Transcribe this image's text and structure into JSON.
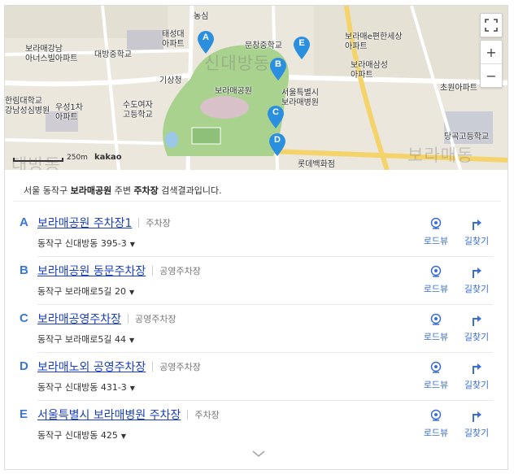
{
  "map": {
    "big_labels": [
      "신대방동",
      "보라매동",
      "대방동"
    ],
    "labels": [
      {
        "text": "농심",
        "key": "nongsim"
      },
      {
        "text": "태성대\n아파트",
        "key": "taesung"
      },
      {
        "text": "문창중학교",
        "key": "munchang"
      },
      {
        "text": "보라매강남\n아너스빌아파트",
        "key": "honors"
      },
      {
        "text": "대방중학교",
        "key": "daebang_ms"
      },
      {
        "text": "보라매e편한세상\n아파트",
        "key": "epyeonhan"
      },
      {
        "text": "보라매삼성\n아파트",
        "key": "samsung"
      },
      {
        "text": "기상청",
        "key": "kisang"
      },
      {
        "text": "보라매공원",
        "key": "park"
      },
      {
        "text": "서울특별시\n보라매병원",
        "key": "hospital"
      },
      {
        "text": "초원아파트",
        "key": "chowon"
      },
      {
        "text": "수도여자\n고등학교",
        "key": "sudo"
      },
      {
        "text": "한림대학교\n강남성심병원",
        "key": "hallym"
      },
      {
        "text": "우성1차\n아파트",
        "key": "woosung"
      },
      {
        "text": "당곡고등학교",
        "key": "danggok"
      },
      {
        "text": "롯데백화점",
        "key": "lotte"
      }
    ],
    "markers": [
      "A",
      "B",
      "C",
      "D",
      "E"
    ],
    "controls": {
      "zoom_in": "+",
      "zoom_out": "−"
    },
    "scale_text": "250m",
    "brand": "kakao"
  },
  "summary": {
    "prefix": "서울 동작구 ",
    "place": "보라매공원",
    "middle": " 주변 ",
    "category": "주차장",
    "suffix": " 검색결과입니다."
  },
  "actions": {
    "roadview": "로드뷰",
    "directions": "길찾기"
  },
  "results": [
    {
      "letter": "A",
      "title": "보라매공원 주차장1",
      "category": "주차장",
      "address": "동작구 신대방동 395-3"
    },
    {
      "letter": "B",
      "title": "보라매공원 동문주차장",
      "category": "공영주차장",
      "address": "동작구 보라매로5길 20"
    },
    {
      "letter": "C",
      "title": "보라매공영주차장",
      "category": "공영주차장",
      "address": "동작구 보라매로5길 44"
    },
    {
      "letter": "D",
      "title": "보라매노외 공영주차장",
      "category": "공영주차장",
      "address": "동작구 신대방동 431-3"
    },
    {
      "letter": "E",
      "title": "서울특별시 보라매병원 주차장",
      "category": "주차장",
      "address": "동작구 신대방동 425"
    }
  ],
  "colors": {
    "accent": "#3a78d4",
    "link": "#1a3fb8",
    "marker": "#2b8fe0",
    "park": "#a9d28f"
  }
}
